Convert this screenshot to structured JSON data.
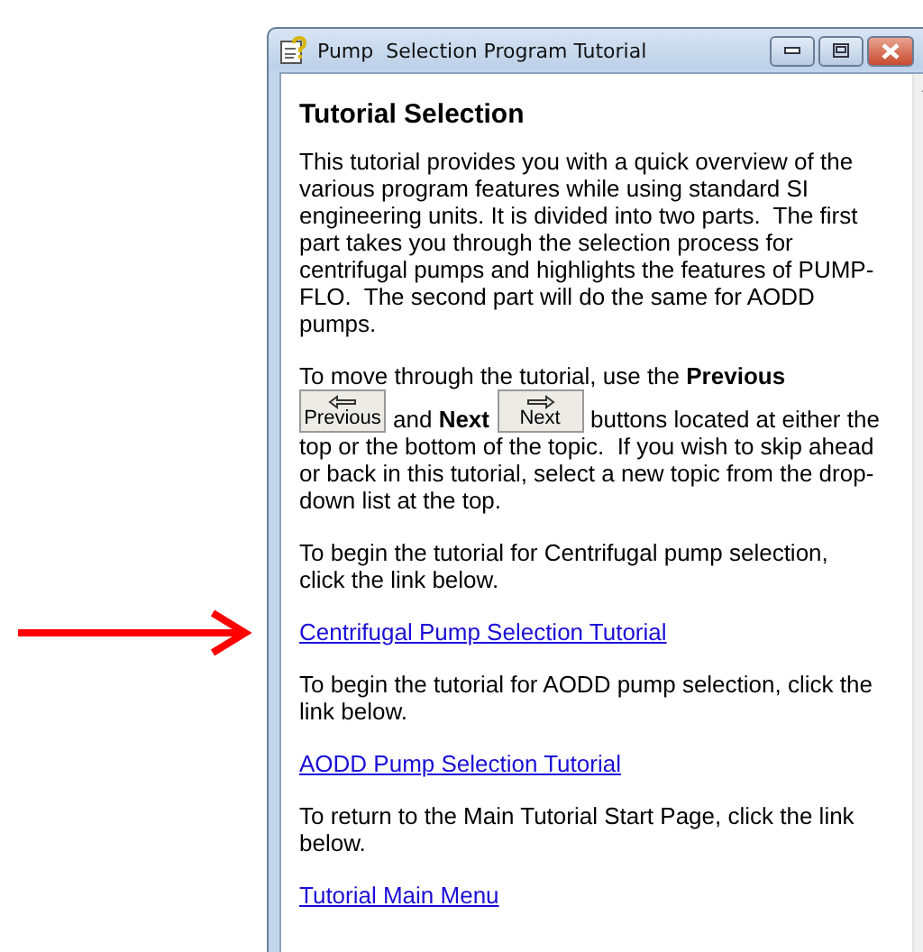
{
  "window": {
    "title": "Pump  Selection Program Tutorial"
  },
  "heading": "Tutorial Selection",
  "blocks": [
    {
      "kind": "text",
      "text": "This tutorial provides you with a quick overview of the various program features while using standard SI engineering units. It is divided into two parts.  The first part takes you through the selection process for centrifugal pumps and highlights the features of PUMP-FLO.  The second part will do the same for AODD pumps."
    },
    {
      "kind": "nav",
      "parts": [
        {
          "kind": "text",
          "text": "To move through the tutorial, use the **Previous**"
        },
        {
          "kind": "previous",
          "label": "Previous"
        },
        {
          "kind": "text",
          "text": "and **Next**"
        },
        {
          "kind": "next",
          "label": "Next"
        },
        {
          "kind": "text",
          "text": "buttons located at either the"
        },
        {
          "kind": "text",
          "text": "top or the bottom of the topic.  If you wish to skip ahead or back in this tutorial, select a new topic from the drop-down list at the top."
        }
      ]
    },
    {
      "kind": "text",
      "text": "To begin the tutorial for Centrifugal pump selection, click the link below."
    },
    {
      "kind": "link",
      "text": "Centrifugal Pump Selection Tutorial"
    },
    {
      "kind": "text",
      "text": "To begin the tutorial for AODD pump selection, click the link below."
    },
    {
      "kind": "link",
      "text": "AODD Pump Selection Tutorial"
    },
    {
      "kind": "text",
      "text": "To return to the Main Tutorial Start Page, click the link below."
    },
    {
      "kind": "link",
      "text": "Tutorial Main Menu"
    }
  ]
}
